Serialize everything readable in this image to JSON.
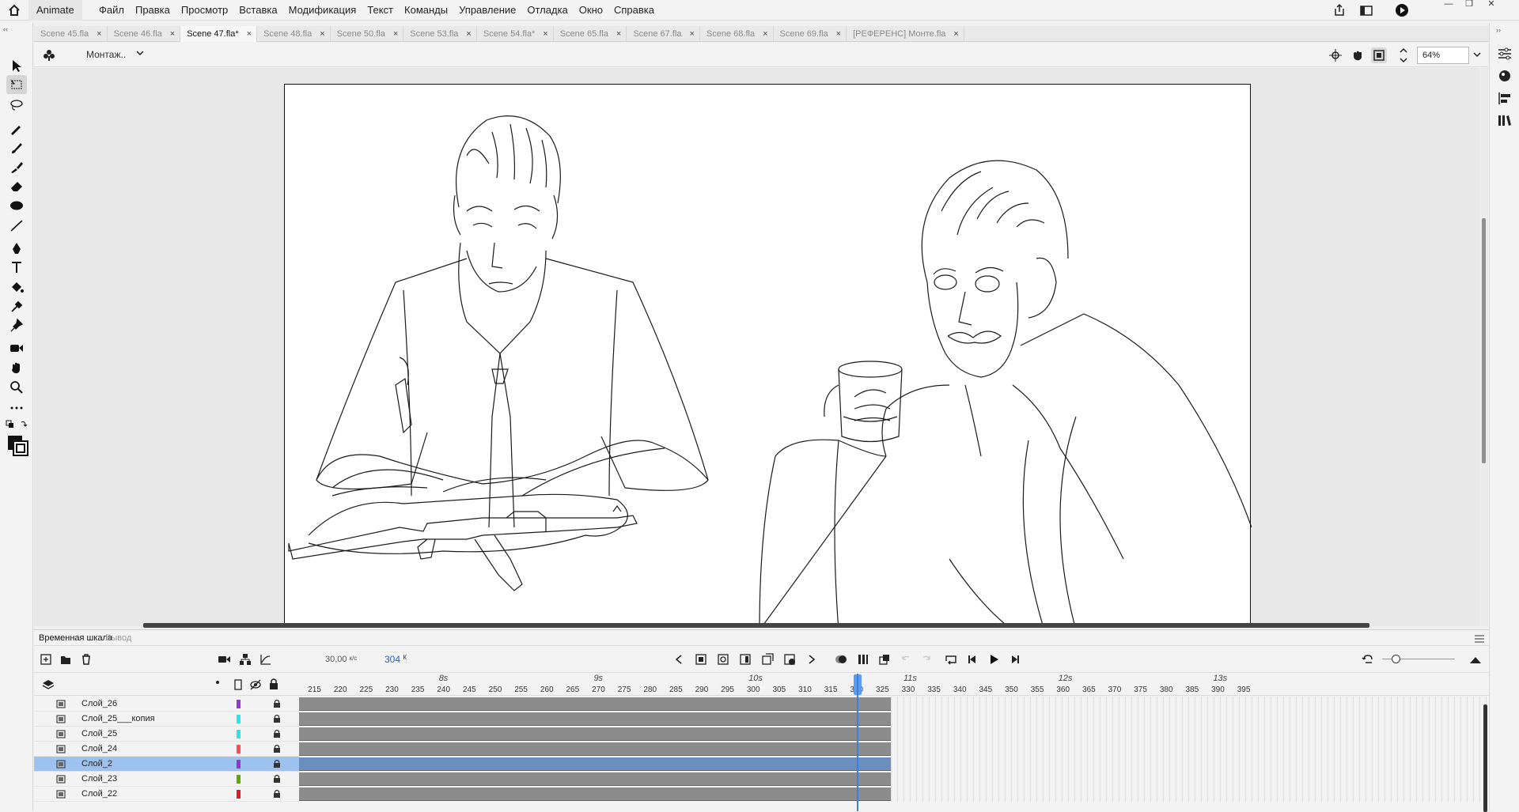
{
  "app": {
    "name": "Animate"
  },
  "menu": [
    "Файл",
    "Правка",
    "Просмотр",
    "Вставка",
    "Модификация",
    "Текст",
    "Команды",
    "Управление",
    "Отладка",
    "Окно",
    "Справка"
  ],
  "window_controls": {
    "minimize": "—",
    "restore": "❐",
    "close": "✕"
  },
  "tabs": [
    {
      "label": "Scene 45.fla",
      "active": false
    },
    {
      "label": "Scene 46.fla",
      "active": false
    },
    {
      "label": "Scene 47.fla*",
      "active": true
    },
    {
      "label": "Scene 48.fla",
      "active": false
    },
    {
      "label": "Scene 50.fla",
      "active": false
    },
    {
      "label": "Scene 53.fla",
      "active": false
    },
    {
      "label": "Scene 54.fla*",
      "active": false
    },
    {
      "label": "Scene 65.fla",
      "active": false
    },
    {
      "label": "Scene 67.fla",
      "active": false
    },
    {
      "label": "Scene 68.fla",
      "active": false
    },
    {
      "label": "Scene 69.fla",
      "active": false
    },
    {
      "label": "[РЕФЕРЕНС] Монте.fla",
      "active": false
    }
  ],
  "tab_close": "×",
  "stage_bar": {
    "scene_label": "Монтаж..",
    "zoom": "64%"
  },
  "timeline": {
    "tab_timeline": "Временная шкала",
    "tab_output": "Вывод",
    "fps": "30,00",
    "fps_unit": "к/с",
    "current_frame": "304",
    "frame_unit": "К",
    "seconds": [
      {
        "label": "8s",
        "frame": 240
      },
      {
        "label": "9s",
        "frame": 270
      },
      {
        "label": "10s",
        "frame": 300
      },
      {
        "label": "11s",
        "frame": 330
      },
      {
        "label": "12s",
        "frame": 360
      },
      {
        "label": "13s",
        "frame": 390
      }
    ],
    "frame_ticks": [
      215,
      220,
      225,
      230,
      235,
      240,
      245,
      250,
      255,
      260,
      265,
      270,
      275,
      280,
      285,
      290,
      295,
      300,
      305,
      310,
      315,
      320,
      325,
      330,
      335,
      340,
      345,
      350,
      355,
      360,
      365,
      370,
      375,
      380,
      385,
      390,
      395
    ],
    "layers": [
      {
        "name": "Слой_26",
        "color": "#9b30d9",
        "selected": false
      },
      {
        "name": "Слой_25___копия",
        "color": "#27e6f0",
        "selected": false
      },
      {
        "name": "Слой_25",
        "color": "#27e6f0",
        "selected": false
      },
      {
        "name": "Слой_24",
        "color": "#ff4b4b",
        "selected": false
      },
      {
        "name": "Слой_2",
        "color": "#9b30d9",
        "selected": true
      },
      {
        "name": "Слой_23",
        "color": "#5fa800",
        "selected": false
      },
      {
        "name": "Слой_22",
        "color": "#e51b1b",
        "selected": false
      }
    ]
  }
}
